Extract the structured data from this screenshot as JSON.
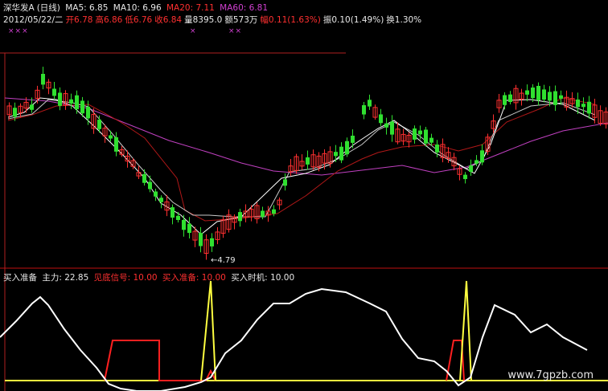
{
  "header": {
    "stock_name": "深华发A",
    "period": "(日线)",
    "ma5": "MA5: 6.85",
    "ma10": "MA10: 6.96",
    "ma20": "MA20: 7.11",
    "ma60": "MA60: 6.81",
    "date": "2012/05/22/二",
    "open": "开6.78",
    "high": "高6.86",
    "low": "低6.76",
    "close": "收6.84",
    "volume": "量8395.0",
    "amount": "额573万",
    "change": "幅0.11(1.63%)",
    "amplitude": "振0.10(1.49%)",
    "turnover": "换1.30%"
  },
  "marks": {
    "left": "×××",
    "mid": "×",
    "right": "××"
  },
  "low_label": "←4.79",
  "indicator": {
    "name": "买入准备",
    "main_force": "主力: 22.85",
    "signal": "见底信号: 10.00",
    "prep": "买入准备: 10.00",
    "timing": "买入时机: 10.00"
  },
  "watermark": "www.7gpzb.com",
  "colors": {
    "up": "#ff3030",
    "down": "#30e030",
    "ma5": "#ffffff",
    "ma10": "#c8c8c8",
    "ma20": "#b01818",
    "ma60": "#c040c0",
    "indicator_white": "#ffffff",
    "indicator_red": "#ff2020",
    "indicator_yellow": "#ffff40",
    "separator": "#c01010"
  }
}
